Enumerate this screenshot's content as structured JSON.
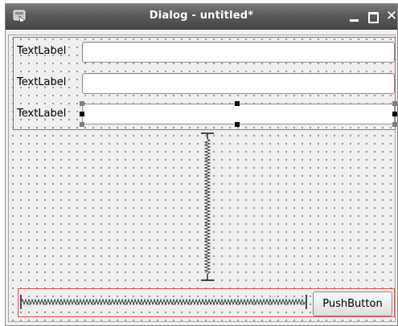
{
  "window": {
    "title": "Dialog - untitled*",
    "icon": "designer-app-icon",
    "controls": {
      "minimize_icon": "minimize-icon",
      "maximize_icon": "maximize-icon",
      "close_icon": "close-icon",
      "close_glyph": "✕"
    }
  },
  "form": {
    "rows": [
      {
        "label": "TextLabel",
        "value": ""
      },
      {
        "label": "TextLabel",
        "value": ""
      },
      {
        "label": "TextLabel",
        "value": "",
        "selected": true
      }
    ],
    "vertical_spacer": "vertical-spacer",
    "horizontal_spacer": "horizontal-spacer",
    "push_button_label": "PushButton"
  },
  "colors": {
    "titlebar": "#5a5a5a",
    "canvas": "#efefef",
    "layout_frame": "#e05050",
    "spacer": "#1f1f1f"
  }
}
